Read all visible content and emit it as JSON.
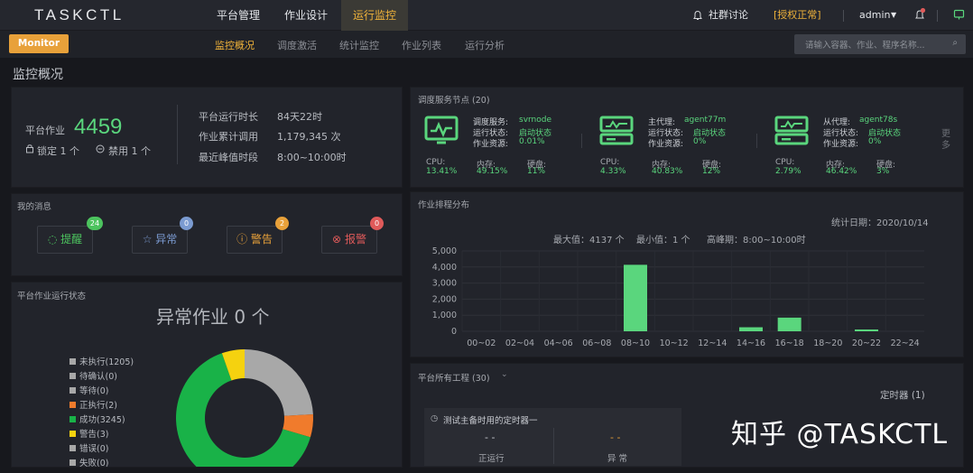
{
  "app": {
    "logo": "TASKCTL"
  },
  "nav": {
    "items": [
      "平台管理",
      "作业设计",
      "运行监控"
    ],
    "active": 2
  },
  "topright": {
    "community": "社群讨论",
    "license": "[授权正常]",
    "user": "admin"
  },
  "subnav": {
    "mode": "Monitor",
    "items": [
      "监控概况",
      "调度激活",
      "统计监控",
      "作业列表",
      "运行分析"
    ],
    "active": 0,
    "search_placeholder": "请输入容器、作业、程序名称...",
    "search_icon": "search-icon"
  },
  "page": {
    "title": "监控概况"
  },
  "summary": {
    "job_label": "平台作业",
    "job_count": "4459",
    "locked": "锁定 1 个",
    "disabled": "禁用 1 个",
    "rows": [
      {
        "label": "平台运行时长",
        "value": "84天22时"
      },
      {
        "label": "作业累计调用",
        "value": "1,179,345 次"
      },
      {
        "label": "最近峰值时段",
        "value": "8:00~10:00时"
      }
    ]
  },
  "nodes": {
    "title": "调度服务节点 (20)",
    "more": "更多",
    "items": [
      {
        "name_label": "调度服务:",
        "name": "svrnode",
        "status_label": "运行状态:",
        "status": "启动状态",
        "res_label": "作业资源:",
        "res": "0.01%",
        "cpu_label": "CPU:",
        "cpu": "13.41%",
        "mem_label": "内存:",
        "mem": "49.15%",
        "disk_label": "硬盘:",
        "disk": "11%"
      },
      {
        "name_label": "主代理:",
        "name": "agent77m",
        "status_label": "运行状态:",
        "status": "启动状态",
        "res_label": "作业资源:",
        "res": "0%",
        "cpu_label": "CPU:",
        "cpu": "4.33%",
        "mem_label": "内存:",
        "mem": "40.83%",
        "disk_label": "硬盘:",
        "disk": "12%"
      },
      {
        "name_label": "从代理:",
        "name": "agent78s",
        "status_label": "运行状态:",
        "status": "启动状态",
        "res_label": "作业资源:",
        "res": "0%",
        "cpu_label": "CPU:",
        "cpu": "2.79%",
        "mem_label": "内存:",
        "mem": "46.42%",
        "disk_label": "硬盘:",
        "disk": "3%"
      }
    ]
  },
  "messages": {
    "title": "我的消息",
    "items": [
      {
        "label": "提醒",
        "count": "24",
        "color": "#4cc35e"
      },
      {
        "label": "异常",
        "count": "0",
        "color": "#7b9bd1"
      },
      {
        "label": "警告",
        "count": "2",
        "color": "#e8a13a"
      },
      {
        "label": "报警",
        "count": "0",
        "color": "#e05a5a"
      }
    ]
  },
  "schedule": {
    "title": "作业排程分布",
    "stat_date": "统计日期：2020/10/14",
    "max": "最大值：4137 个",
    "min": "最小值：1 个",
    "peak": "高峰期：8:00~10:00时",
    "bar_color": "#5ad67d"
  },
  "chart_data": {
    "type": "bar",
    "categories": [
      "00~02",
      "02~04",
      "04~06",
      "06~08",
      "08~10",
      "10~12",
      "12~14",
      "14~16",
      "16~18",
      "18~20",
      "20~22",
      "22~24"
    ],
    "values": [
      0,
      0,
      0,
      0,
      4137,
      0,
      0,
      250,
      850,
      0,
      10,
      0
    ],
    "yticks": [
      "5,000",
      "4,000",
      "3,000",
      "2,000",
      "1,000",
      "0"
    ],
    "ylim": [
      0,
      5000
    ],
    "title": "",
    "xlabel": "",
    "ylabel": ""
  },
  "status": {
    "title": "平台作业运行状态",
    "headline": "异常作业 0 个",
    "legend": [
      {
        "label": "未执行(1205)",
        "value": 1205,
        "color": "#a8a8a8"
      },
      {
        "label": "待确认(0)",
        "value": 0,
        "color": "#a8a8a8"
      },
      {
        "label": "等待(0)",
        "value": 0,
        "color": "#a8a8a8"
      },
      {
        "label": "正执行(2)",
        "value": 2,
        "color": "#f07b2c"
      },
      {
        "label": "成功(3245)",
        "value": 3245,
        "color": "#19b248"
      },
      {
        "label": "警告(3)",
        "value": 3,
        "color": "#f5d20f"
      },
      {
        "label": "错误(0)",
        "value": 0,
        "color": "#a8a8a8"
      },
      {
        "label": "失败(0)",
        "value": 0,
        "color": "#a8a8a8"
      }
    ]
  },
  "projects": {
    "title": "平台所有工程 (30)",
    "timer": "定时器 (1)",
    "card_title": "测试主备时用的定时器一",
    "col1": "- -",
    "col1_label": "正运行",
    "col2": "- -",
    "col2_label": "异 常"
  },
  "watermark": "知乎 @TASKCTL"
}
